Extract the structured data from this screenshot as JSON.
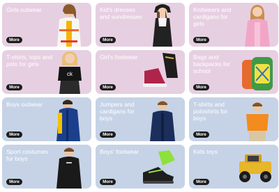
{
  "more_label": "More",
  "cards": [
    {
      "title": "Girls outwear",
      "icon": "child-outerwear-icon"
    },
    {
      "title": "Kid's dresses and sundresses",
      "icon": "dress-icon"
    },
    {
      "title": "Knitwears and cardigans for girls",
      "icon": "cardigan-icon"
    },
    {
      "title": "T-shirts, tops and polo for girls",
      "icon": "tshirt-icon"
    },
    {
      "title": "Girl's footwear",
      "icon": "sneaker-icon"
    },
    {
      "title": "Bags and backpacks for school",
      "icon": "backpack-icon"
    },
    {
      "title": "Boys outwear",
      "icon": "jacket-icon"
    },
    {
      "title": "Jumpers and cardigans for boys",
      "icon": "jumper-icon"
    },
    {
      "title": "T-shirts and poloshirts for boys",
      "icon": "tshirt-icon"
    },
    {
      "title": "Sport costumes for boys",
      "icon": "tracksuit-icon"
    },
    {
      "title": "Boys' footwear",
      "icon": "sneaker-icon"
    },
    {
      "title": "Kids toys",
      "icon": "toy-car-icon"
    }
  ],
  "colors": {
    "pink": "#e7cfe2",
    "blue": "#c6d3e6",
    "button": "#1c1c1c"
  }
}
